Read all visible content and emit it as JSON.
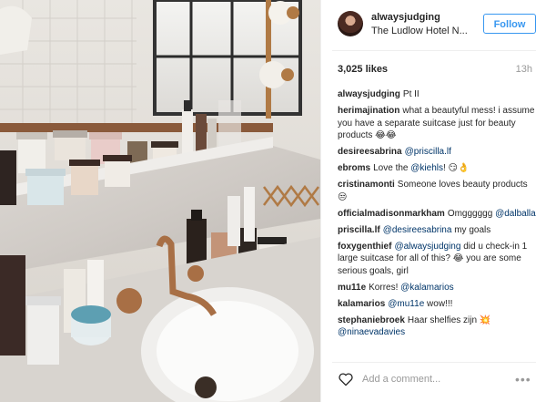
{
  "post": {
    "username": "alwaysjudging",
    "location": "The Ludlow Hotel N...",
    "follow_label": "Follow",
    "likes": "3,025 likes",
    "time": "13h"
  },
  "comments": [
    {
      "user": "alwaysjudging",
      "parts": [
        {
          "t": "Pt II"
        }
      ]
    },
    {
      "user": "herimajination",
      "parts": [
        {
          "t": "what a beautyful mess! i assume you have a separate suitcase just for beauty products 😂😂"
        }
      ]
    },
    {
      "user": "desireesabrina",
      "parts": [
        {
          "t": "@priscilla.lf",
          "m": true
        }
      ]
    },
    {
      "user": "ebroms",
      "parts": [
        {
          "t": "Love the "
        },
        {
          "t": "@kiehls",
          "m": true
        },
        {
          "t": "! 😏👌"
        }
      ]
    },
    {
      "user": "cristinamonti",
      "parts": [
        {
          "t": "Someone loves beauty products 😒"
        }
      ]
    },
    {
      "user": "officialmadisonmarkham",
      "parts": [
        {
          "t": "Omgggggg "
        },
        {
          "t": "@dalballa",
          "m": true
        }
      ]
    },
    {
      "user": "priscilla.lf",
      "parts": [
        {
          "t": "@desireesabrina",
          "m": true
        },
        {
          "t": " my goals"
        }
      ]
    },
    {
      "user": "foxygenthief",
      "parts": [
        {
          "t": "@alwaysjudging",
          "m": true
        },
        {
          "t": " did u check-in 1 large suitcase for all of this? 😂 you are some serious goals, girl"
        }
      ]
    },
    {
      "user": "mu11e",
      "parts": [
        {
          "t": "Korres! "
        },
        {
          "t": "@kalamarios",
          "m": true
        }
      ]
    },
    {
      "user": "kalamarios",
      "parts": [
        {
          "t": "@mu11e",
          "m": true
        },
        {
          "t": " wow!!!"
        }
      ]
    },
    {
      "user": "stephaniebroek",
      "parts": [
        {
          "t": "Haar shelfies zijn 💥 "
        },
        {
          "t": "@ninaevadavies",
          "m": true
        }
      ]
    }
  ],
  "add_comment_placeholder": "Add a comment...",
  "icons": {
    "like": "heart-icon",
    "more": "more-options-icon"
  },
  "colors": {
    "accent": "#3897f0",
    "mention": "#003569"
  }
}
